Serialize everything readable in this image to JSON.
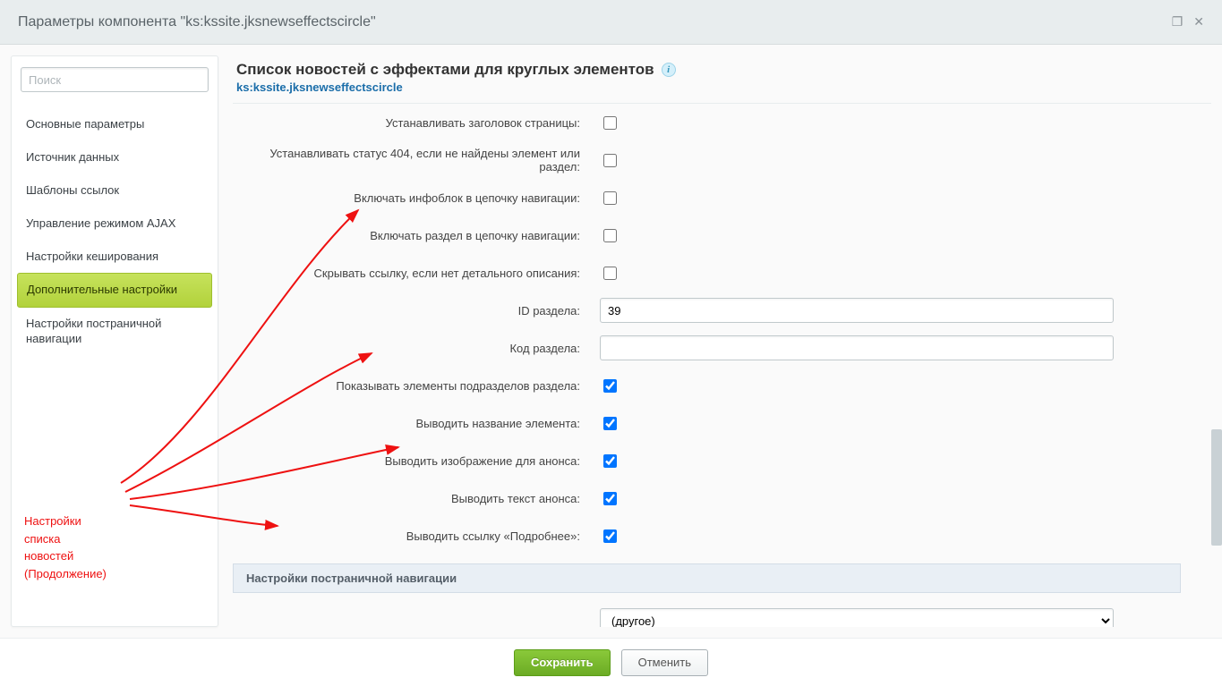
{
  "window": {
    "title": "Параметры компонента \"ks:kssite.jksnewseffectscircle\""
  },
  "sidebar": {
    "search_placeholder": "Поиск",
    "items": [
      "Основные параметры",
      "Источник данных",
      "Шаблоны ссылок",
      "Управление режимом AJAX",
      "Настройки кеширования",
      "Дополнительные настройки",
      "Настройки постраничной навигации"
    ],
    "active_index": 5,
    "annotation": "Настройки\nсписка\nновостей\n(Продолжение)"
  },
  "main": {
    "title": "Список новостей с эффектами для круглых элементов",
    "subtitle": "ks:kssite.jksnewseffectscircle",
    "rows": [
      {
        "label": "Устанавливать заголовок страницы:",
        "type": "checkbox",
        "checked": false
      },
      {
        "label": "Устанавливать статус 404, если не найдены элемент или раздел:",
        "type": "checkbox",
        "checked": false
      },
      {
        "label": "Включать инфоблок в цепочку навигации:",
        "type": "checkbox",
        "checked": false
      },
      {
        "label": "Включать раздел в цепочку навигации:",
        "type": "checkbox",
        "checked": false
      },
      {
        "label": "Скрывать ссылку, если нет детального описания:",
        "type": "checkbox",
        "checked": false
      },
      {
        "label": "ID раздела:",
        "type": "text",
        "value": "39"
      },
      {
        "label": "Код раздела:",
        "type": "text",
        "value": ""
      },
      {
        "label": "Показывать элементы подразделов раздела:",
        "type": "checkbox",
        "checked": true
      },
      {
        "label": "Выводить название элемента:",
        "type": "checkbox",
        "checked": true
      },
      {
        "label": "Выводить изображение для анонса:",
        "type": "checkbox",
        "checked": true
      },
      {
        "label": "Выводить текст анонса:",
        "type": "checkbox",
        "checked": true
      },
      {
        "label": "Выводить ссылку «Подробнее»:",
        "type": "checkbox",
        "checked": true
      }
    ],
    "section_band": "Настройки постраничной навигации",
    "select_value": "(другое)"
  },
  "footer": {
    "save": "Сохранить",
    "cancel": "Отменить"
  }
}
